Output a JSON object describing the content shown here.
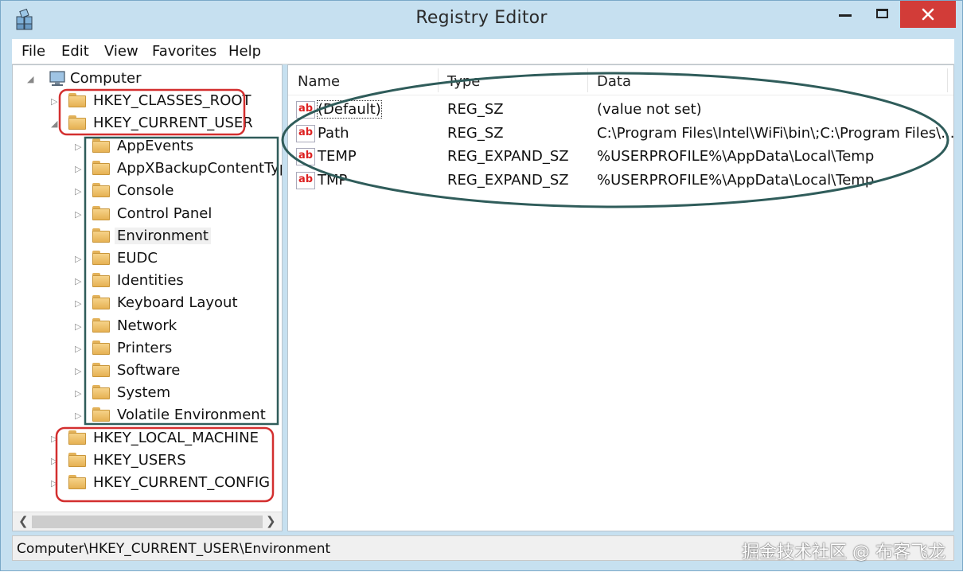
{
  "window": {
    "title": "Registry Editor"
  },
  "menu": [
    "File",
    "Edit",
    "View",
    "Favorites",
    "Help"
  ],
  "tree": {
    "root": "Computer",
    "hives_top": [
      "HKEY_CLASSES_ROOT",
      "HKEY_CURRENT_USER"
    ],
    "hkcu_children": [
      "AppEvents",
      "AppXBackupContentTyp",
      "Console",
      "Control Panel",
      "Environment",
      "EUDC",
      "Identities",
      "Keyboard Layout",
      "Network",
      "Printers",
      "Software",
      "System",
      "Volatile Environment"
    ],
    "hives_bottom": [
      "HKEY_LOCAL_MACHINE",
      "HKEY_USERS",
      "HKEY_CURRENT_CONFIG"
    ],
    "selected": "Environment"
  },
  "list": {
    "columns": {
      "name": "Name",
      "type": "Type",
      "data": "Data"
    },
    "rows": [
      {
        "name": "(Default)",
        "type": "REG_SZ",
        "data": "(value not set)"
      },
      {
        "name": "Path",
        "type": "REG_SZ",
        "data": "C:\\Program Files\\Intel\\WiFi\\bin\\;C:\\Program Files\\..."
      },
      {
        "name": "TEMP",
        "type": "REG_EXPAND_SZ",
        "data": "%USERPROFILE%\\AppData\\Local\\Temp"
      },
      {
        "name": "TMP",
        "type": "REG_EXPAND_SZ",
        "data": "%USERPROFILE%\\AppData\\Local\\Temp"
      }
    ],
    "icon_text": "ab"
  },
  "status": {
    "path": "Computer\\HKEY_CURRENT_USER\\Environment"
  },
  "watermark": "掘金技术社区 @ 布客飞龙",
  "colors": {
    "annotation_red": "#d32f2f",
    "annotation_teal": "#2f5c5a",
    "close_button": "#d23c38"
  }
}
